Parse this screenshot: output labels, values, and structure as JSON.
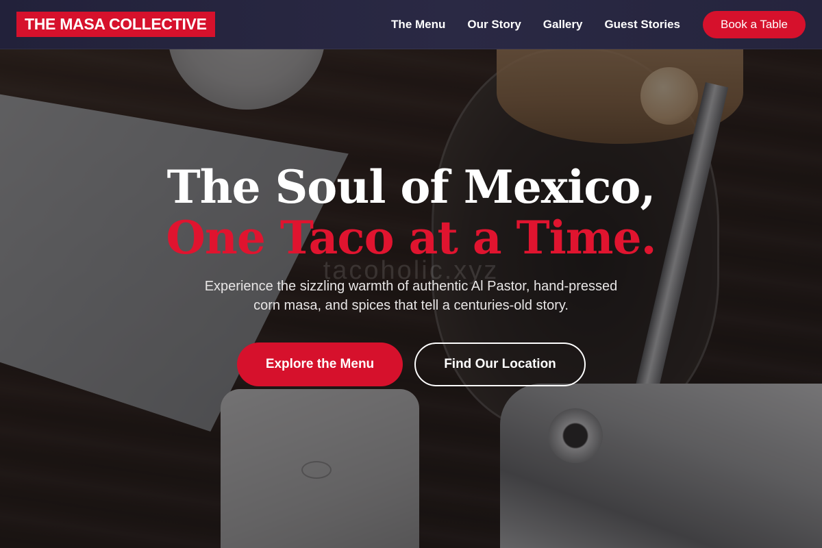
{
  "nav": {
    "brand": "THE MASA COLLECTIVE",
    "links": [
      {
        "label": "The Menu"
      },
      {
        "label": "Our Story"
      },
      {
        "label": "Gallery"
      },
      {
        "label": "Guest Stories"
      }
    ],
    "book_button": "Book a Table"
  },
  "hero": {
    "headline_line1": "The Soul of Mexico,",
    "headline_line2": "One Taco at a Time.",
    "watermark": "tacoholic.xyz",
    "subtext": "Experience the sizzling warmth of authentic Al Pastor, hand-pressed corn masa, and spices that tell a centuries-old story.",
    "primary_cta": "Explore the Menu",
    "secondary_cta": "Find Our Location"
  },
  "colors": {
    "accent_red": "#d6112c",
    "nav_bg": "#2a2944",
    "text_light": "#ffffff"
  }
}
